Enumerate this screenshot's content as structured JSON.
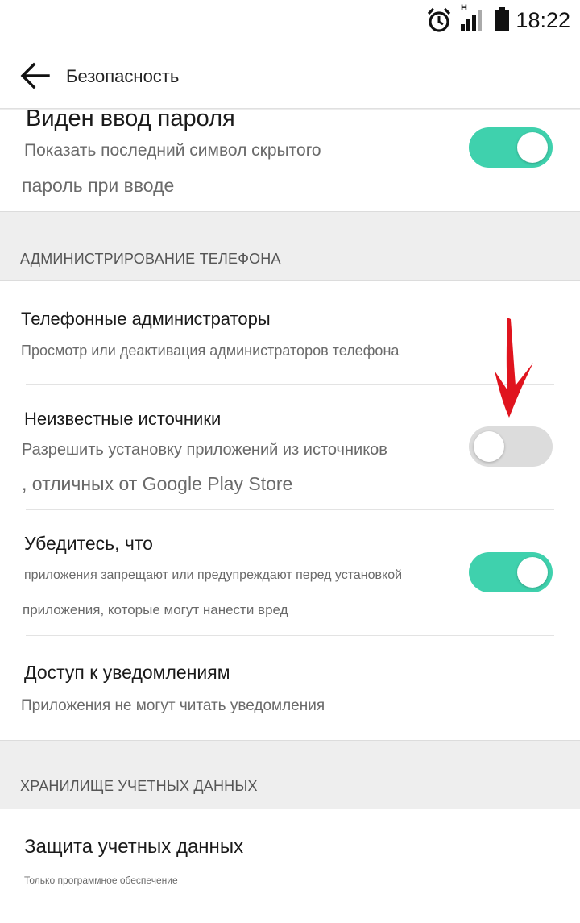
{
  "status_bar": {
    "time": "18:22",
    "network_type": "H",
    "icons": [
      "alarm-icon",
      "signal-icon",
      "battery-icon"
    ]
  },
  "toolbar": {
    "title": "Безопасность",
    "back_icon": "arrow-left-icon"
  },
  "rows": {
    "password_visible": {
      "title": "Виден ввод пароля",
      "subtitle_line1": "Показать последний символ скрытого",
      "subtitle_line2": "пароль при вводе",
      "enabled": true
    },
    "phone_admins": {
      "title": "Телефонные администраторы",
      "subtitle": "Просмотр или деактивация администраторов телефона"
    },
    "unknown_sources": {
      "title": "Неизвестные источники",
      "subtitle_line1": "Разрешить установку приложений из источников",
      "subtitle_line2": ", отличных от Google Play Store",
      "enabled": false
    },
    "verify_apps": {
      "title": "Убедитесь, что",
      "subtitle_line1": "приложения запрещают или предупреждают перед установкой",
      "subtitle_line2": "приложения, которые могут нанести вред",
      "enabled": true
    },
    "notification_access": {
      "title": "Доступ к уведомлениям",
      "subtitle": "Приложения не могут читать уведомления"
    },
    "credential_protection": {
      "title": "Защита учетных данных",
      "subtitle": "Только программное обеспечение"
    }
  },
  "sections": {
    "phone_admin": "АДМИНИСТРИРОВАНИЕ ТЕЛЕФОНА",
    "credential_storage": "ХРАНИЛИЩЕ УЧЕТНЫХ ДАННЫХ"
  },
  "colors": {
    "toggle_on": "#3fd1ad",
    "toggle_off": "#dcdcdc",
    "section_bg": "#eeeeee",
    "annotation_arrow": "#e0141e"
  }
}
